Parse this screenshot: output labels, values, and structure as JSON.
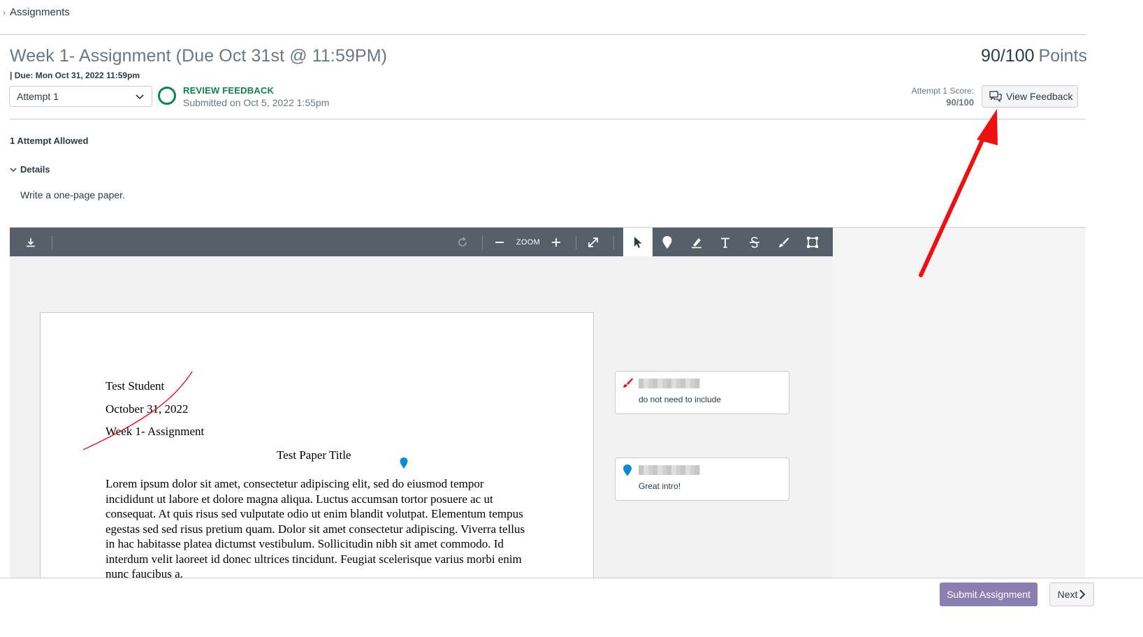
{
  "breadcrumb": {
    "label": "Assignments"
  },
  "assignment": {
    "title": "Week 1- Assignment (Due Oct 31st @ 11:59PM)",
    "due": "| Due: Mon Oct 31, 2022 11:59pm",
    "points_value": "90/100",
    "points_label": "Points"
  },
  "attempt": {
    "selected": "Attempt 1",
    "status_title": "REVIEW FEEDBACK",
    "status_sub": "Submitted on Oct 5, 2022 1:55pm",
    "score_label": "Attempt 1 Score:",
    "score_value": "90/100",
    "view_feedback_label": "View Feedback"
  },
  "details": {
    "attempts_allowed": "1 Attempt Allowed",
    "toggle_label": "Details",
    "description": "Write a one-page paper."
  },
  "toolbar": {
    "zoom_label": "ZOOM"
  },
  "document": {
    "line1": "Test Student",
    "line2": "October 31, 2022",
    "line3": "Week 1- Assignment",
    "paper_title": "Test Paper Title",
    "paragraph": "Lorem ipsum dolor sit amet, consectetur adipiscing elit, sed do eiusmod tempor incididunt ut labore et dolore magna aliqua. Luctus accumsan tortor posuere ac ut consequat. At quis risus sed vulputate odio ut enim blandit volutpat. Elementum tempus egestas sed sed risus pretium quam. Dolor sit amet consectetur adipiscing. Viverra tellus in hac habitasse platea dictumst vestibulum. Sollicitudin nibh sit amet commodo. Id interdum velit laoreet id donec ultrices tincidunt. Feugiat scelerisque varius morbi enim nunc faucibus a."
  },
  "comments": [
    {
      "text": "do not need to include",
      "icon": "freehand-draw-icon"
    },
    {
      "text": "Great intro!",
      "icon": "map-pin-icon"
    }
  ],
  "footer": {
    "submit_label": "Submit Assignment",
    "next_label": "Next"
  },
  "colors": {
    "accent_green": "#0b874b",
    "toolbar_bg": "#56606a",
    "submit_bg": "#8a7fb0",
    "annotation_red": "#e0141e",
    "pin_blue": "#0a8ad6"
  }
}
